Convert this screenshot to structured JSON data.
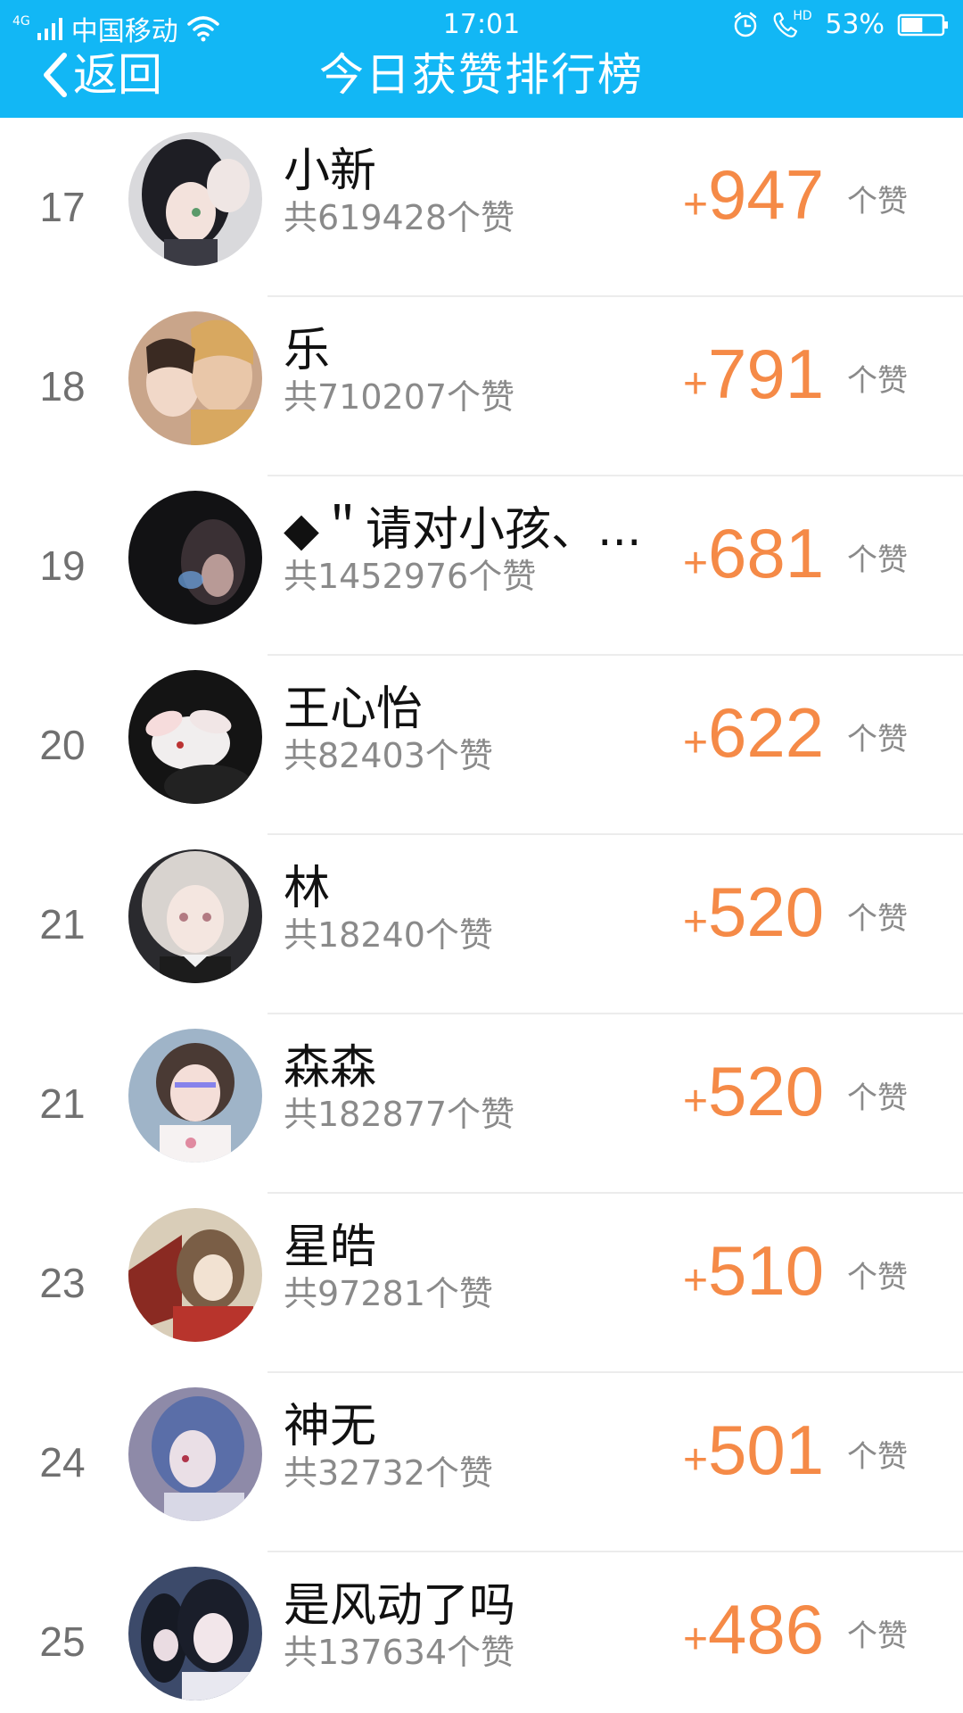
{
  "status_bar": {
    "network_type": "4G",
    "carrier": "中国移动",
    "time": "17:01",
    "hd_label": "HD",
    "battery": "53%",
    "battery_level": 0.53
  },
  "nav": {
    "back_label": "返回",
    "title": "今日获赞排行榜"
  },
  "colors": {
    "header_bg": "#12b7f5",
    "accent_orange": "#f58a47",
    "secondary_text": "#8a8a8a",
    "rank_text": "#707070"
  },
  "icons": {
    "signal": "signal-bars-icon",
    "wifi": "wifi-icon",
    "alarm": "alarm-clock-icon",
    "hd_call": "hd-call-icon",
    "battery": "battery-icon",
    "back": "chevron-left-icon",
    "name_prefix_symbol": "◆"
  },
  "list": {
    "plus_sign": "+",
    "unit_label": "个赞",
    "rows": [
      {
        "rank": "17",
        "name": "小新",
        "total": "共619428个赞",
        "today": "947",
        "avatar": "anime-girl-avatar"
      },
      {
        "rank": "18",
        "name": "乐",
        "total": "共710207个赞",
        "today": "791",
        "avatar": "couple-photo-avatar"
      },
      {
        "rank": "19",
        "name": "◆＂请对小孩、...",
        "total": "共1452976个赞",
        "today": "681",
        "avatar": "dark-photo-avatar"
      },
      {
        "rank": "20",
        "name": "王心怡",
        "total": "共82403个赞",
        "today": "622",
        "avatar": "rabbit-avatar"
      },
      {
        "rank": "21",
        "name": "林",
        "total": "共18240个赞",
        "today": "520",
        "avatar": "anime-silver-hair-avatar"
      },
      {
        "rank": "21",
        "name": "森森",
        "total": "共182877个赞",
        "today": "520",
        "avatar": "girl-selfie-avatar"
      },
      {
        "rank": "23",
        "name": "星皓",
        "total": "共97281个赞",
        "today": "510",
        "avatar": "anime-fan-girl-avatar"
      },
      {
        "rank": "24",
        "name": "神无",
        "total": "共32732个赞",
        "today": "501",
        "avatar": "anime-blue-hair-avatar"
      },
      {
        "rank": "25",
        "name": "是风动了吗",
        "total": "共137634个赞",
        "today": "486",
        "avatar": "anime-dark-hair-avatar"
      }
    ]
  }
}
